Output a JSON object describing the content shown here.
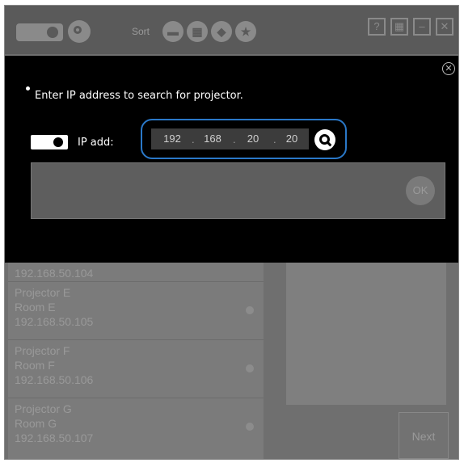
{
  "topbar": {
    "sort_label": "Sort",
    "sort_buttons": [
      "projector-sort-icon",
      "building-sort-icon",
      "shield-sort-icon",
      "star-sort-icon"
    ],
    "window_buttons": [
      "?",
      "grid",
      "minimize",
      "close"
    ]
  },
  "dialog": {
    "instruction": "Enter IP address to search for projector.",
    "ip_label": "IP add:",
    "ip": {
      "o1": "192",
      "o2": "168",
      "o3": "20",
      "o4": "20",
      "sep": "."
    },
    "ok_label": "OK"
  },
  "list": {
    "partial_ip": "192.168.50.104",
    "items": [
      {
        "name": "Projector E",
        "room": "Room E",
        "ip": "192.168.50.105"
      },
      {
        "name": "Projector F",
        "room": "Room F",
        "ip": "192.168.50.106"
      },
      {
        "name": "Projector G",
        "room": "Room G",
        "ip": "192.168.50.107"
      }
    ]
  },
  "footer": {
    "next_label": "Next"
  },
  "colors": {
    "highlight": "#2a78c8",
    "dialog_bg": "#000000",
    "app_bg": "#6f6f6f"
  }
}
